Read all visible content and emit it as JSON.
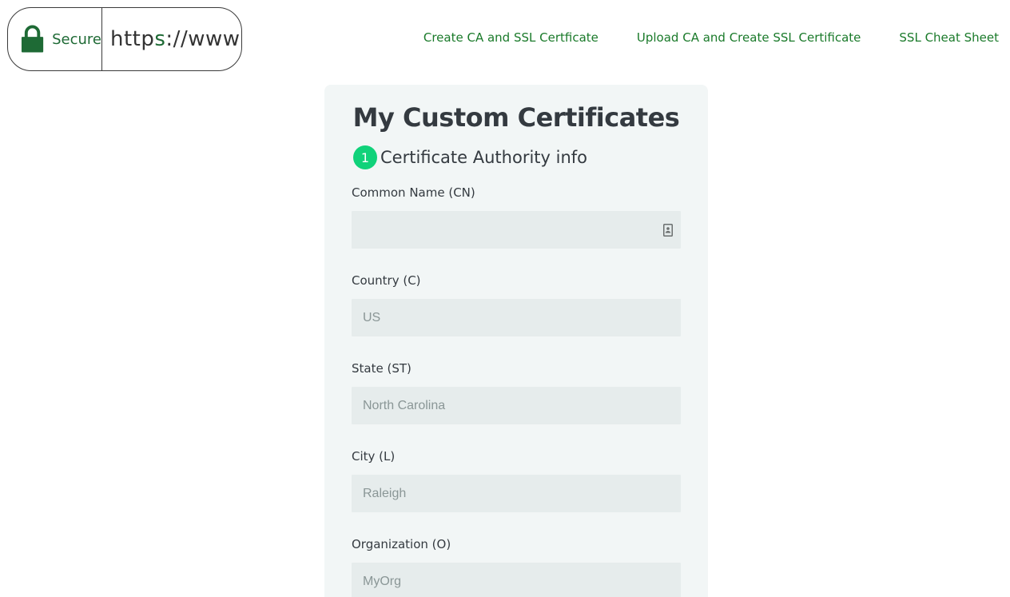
{
  "logo": {
    "secure_text": "Secure",
    "url_text_prefix": "http",
    "url_text_s": "s",
    "url_text_rest": "://www",
    "brand_color": "#1e6a35"
  },
  "nav": {
    "items": [
      {
        "label": "Create CA and SSL Certficate"
      },
      {
        "label": "Upload CA and Create SSL Certificate"
      },
      {
        "label": "SSL Cheat Sheet"
      }
    ],
    "link_color": "#1a7a2a"
  },
  "card": {
    "title": "My Custom Certificates",
    "step": {
      "number": "1",
      "title": "Certificate Authority info",
      "badge_color": "#10d27a"
    },
    "fields": [
      {
        "label": "Common Name (CN)",
        "value": "",
        "placeholder": "",
        "icon": "contact-card-icon"
      },
      {
        "label": "Country (C)",
        "value": "",
        "placeholder": "US"
      },
      {
        "label": "State (ST)",
        "value": "",
        "placeholder": "North Carolina"
      },
      {
        "label": "City (L)",
        "value": "",
        "placeholder": "Raleigh"
      },
      {
        "label": "Organization (O)",
        "value": "",
        "placeholder": "MyOrg"
      }
    ]
  }
}
